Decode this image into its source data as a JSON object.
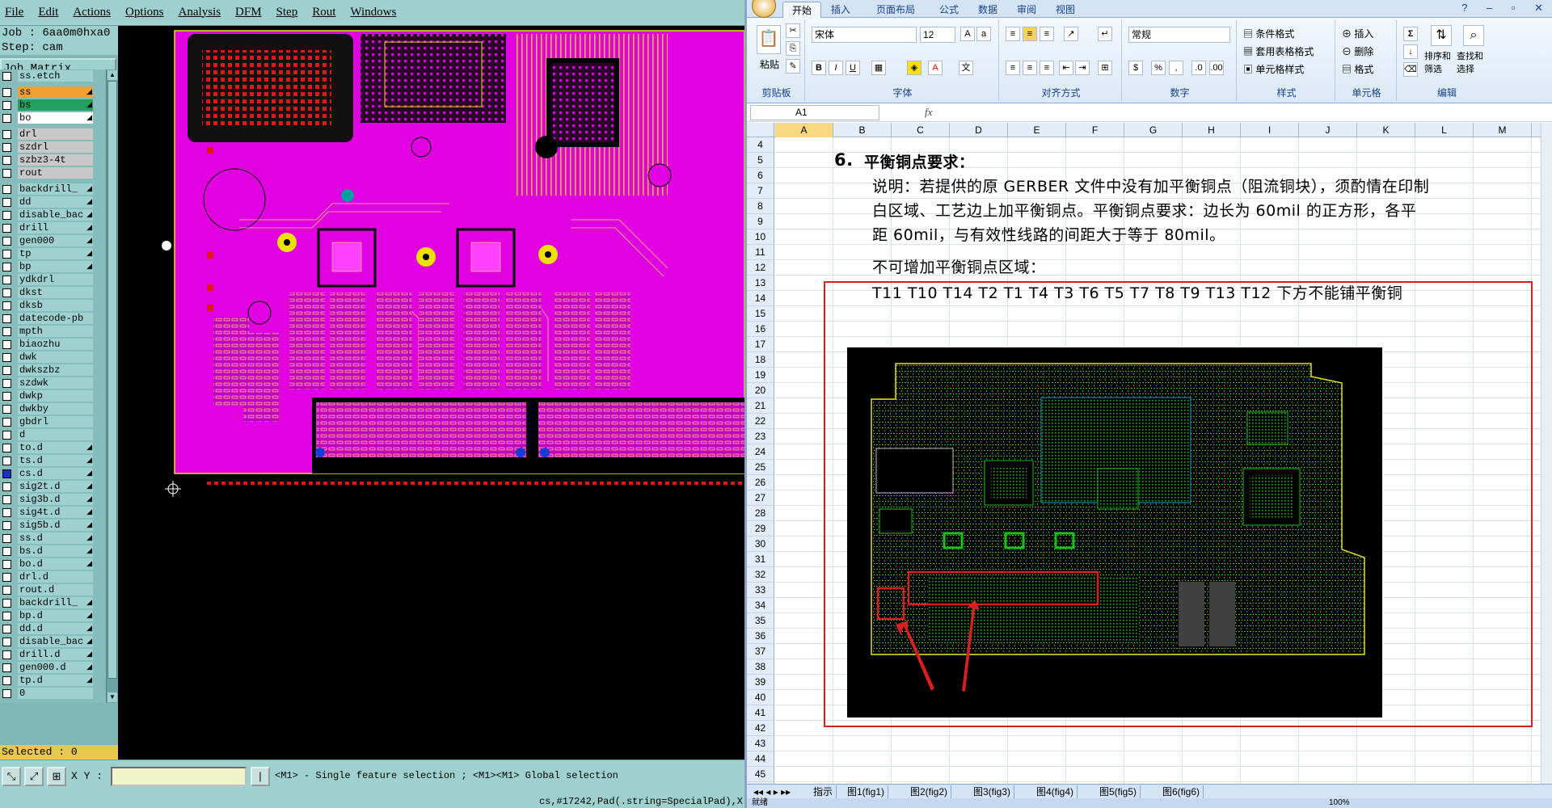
{
  "cam": {
    "menu": [
      "File",
      "Edit",
      "Actions",
      "Options",
      "Analysis",
      "DFM",
      "Step",
      "Rout",
      "Windows"
    ],
    "job_line": "Job : 6aa0m0hxa0",
    "step_line": "Step: cam",
    "job_matrix_button": "Job Matrix ...",
    "layers": [
      {
        "name": "ss.etch",
        "color": "#9fd0d0",
        "group_start": false
      },
      {
        "name": "ss",
        "color": "#f0a030",
        "group_start": true,
        "arrow": true
      },
      {
        "name": "bs",
        "color": "#20a060",
        "arrow": true
      },
      {
        "name": "bo",
        "color": "#ffffff",
        "arrow": true
      },
      {
        "name": "drl",
        "color": "#c8c8c8",
        "group_start": true
      },
      {
        "name": "szdrl",
        "color": "#c8c8c8"
      },
      {
        "name": "szbz3-4t",
        "color": "#c8c8c8"
      },
      {
        "name": "rout",
        "color": "#c8c8c8"
      },
      {
        "name": "backdrill_",
        "color": "#9fd0d0",
        "group_start": true,
        "arrow": true
      },
      {
        "name": "dd",
        "color": "#9fd0d0",
        "arrow": true
      },
      {
        "name": "disable_bac",
        "color": "#9fd0d0",
        "arrow": true
      },
      {
        "name": "drill",
        "color": "#9fd0d0",
        "arrow": true
      },
      {
        "name": "gen000",
        "color": "#9fd0d0",
        "arrow": true
      },
      {
        "name": "tp",
        "color": "#9fd0d0",
        "arrow": true
      },
      {
        "name": "bp",
        "color": "#9fd0d0",
        "arrow": true
      },
      {
        "name": "ydkdrl",
        "color": "#9fd0d0"
      },
      {
        "name": "dkst",
        "color": "#9fd0d0"
      },
      {
        "name": "dksb",
        "color": "#9fd0d0"
      },
      {
        "name": "datecode-pb",
        "color": "#9fd0d0"
      },
      {
        "name": "mpth",
        "color": "#9fd0d0"
      },
      {
        "name": "biaozhu",
        "color": "#9fd0d0"
      },
      {
        "name": "dwk",
        "color": "#9fd0d0"
      },
      {
        "name": "dwkszbz",
        "color": "#9fd0d0"
      },
      {
        "name": "szdwk",
        "color": "#9fd0d0"
      },
      {
        "name": "dwkp",
        "color": "#9fd0d0"
      },
      {
        "name": "dwkby",
        "color": "#9fd0d0"
      },
      {
        "name": "gbdrl",
        "color": "#9fd0d0"
      },
      {
        "name": "d",
        "color": "#9fd0d0"
      },
      {
        "name": "to.d",
        "color": "#9fd0d0",
        "arrow": true
      },
      {
        "name": "ts.d",
        "color": "#9fd0d0",
        "arrow": true
      },
      {
        "name": "cs.d",
        "color": "#9fd0d0",
        "arrow": true,
        "checked": true
      },
      {
        "name": "sig2t.d",
        "color": "#9fd0d0",
        "arrow": true
      },
      {
        "name": "sig3b.d",
        "color": "#9fd0d0",
        "arrow": true
      },
      {
        "name": "sig4t.d",
        "color": "#9fd0d0",
        "arrow": true
      },
      {
        "name": "sig5b.d",
        "color": "#9fd0d0",
        "arrow": true
      },
      {
        "name": "ss.d",
        "color": "#9fd0d0",
        "arrow": true
      },
      {
        "name": "bs.d",
        "color": "#9fd0d0",
        "arrow": true
      },
      {
        "name": "bo.d",
        "color": "#9fd0d0",
        "arrow": true
      },
      {
        "name": "drl.d",
        "color": "#9fd0d0"
      },
      {
        "name": "rout.d",
        "color": "#9fd0d0"
      },
      {
        "name": "backdrill_",
        "color": "#9fd0d0",
        "arrow": true
      },
      {
        "name": "bp.d",
        "color": "#9fd0d0",
        "arrow": true
      },
      {
        "name": "dd.d",
        "color": "#9fd0d0",
        "arrow": true
      },
      {
        "name": "disable_bac",
        "color": "#9fd0d0",
        "arrow": true
      },
      {
        "name": "drill.d",
        "color": "#9fd0d0",
        "arrow": true
      },
      {
        "name": "gen000.d",
        "color": "#9fd0d0",
        "arrow": true
      },
      {
        "name": "tp.d",
        "color": "#9fd0d0",
        "arrow": true
      },
      {
        "name": "0",
        "color": "#9fd0d0"
      }
    ],
    "selected": "Selected : 0",
    "xy_label": "X Y :",
    "xy_value": "",
    "hint": "<M1> - Single feature selection ; <M1><M1> Global selection",
    "status": "cs,#17242,Pad(.string=SpecialPad),X"
  },
  "excel": {
    "tabs": [
      "开始",
      "插入",
      "页面布局",
      "公式",
      "数据",
      "审阅",
      "视图"
    ],
    "clipboard": {
      "paste": "粘贴",
      "group": "剪贴板"
    },
    "font": {
      "name": "宋体",
      "size": "12",
      "group": "字体"
    },
    "align_group": "对齐方式",
    "number": {
      "format": "常规",
      "group": "数字"
    },
    "styles": {
      "cond": "条件格式",
      "table": "套用表格格式",
      "cell": "单元格样式",
      "group": "样式"
    },
    "cells": {
      "insert": "插入",
      "delete": "删除",
      "format": "格式",
      "group": "单元格"
    },
    "editing": {
      "sort": "排序和筛选",
      "find": "查找和选择",
      "group": "编辑"
    },
    "name_box": "A1",
    "fx": "fx",
    "columns": [
      "A",
      "B",
      "C",
      "D",
      "E",
      "F",
      "G",
      "H",
      "I",
      "J",
      "K",
      "L",
      "M"
    ],
    "rows": [
      "4",
      "5",
      "6",
      "7",
      "8",
      "9",
      "10",
      "11",
      "12",
      "13",
      "14",
      "15",
      "16",
      "17",
      "18",
      "19",
      "20",
      "21",
      "22",
      "23",
      "24",
      "25",
      "26",
      "27",
      "28",
      "29",
      "30",
      "31",
      "32",
      "33",
      "34",
      "35",
      "36",
      "37",
      "38",
      "39",
      "40",
      "41",
      "42",
      "43",
      "44",
      "45"
    ],
    "doc": {
      "heading_num": "6.",
      "heading": "平衡铜点要求：",
      "line1": "说明：若提供的原 GERBER 文件中没有加平衡铜点（阻流铜块），须酌情在印制",
      "line2": "白区域、工艺边上加平衡铜点。平衡铜点要求：边长为 60mil 的正方形，各平",
      "line3": "距 60mil，与有效性线路的间距大于等于 80mil。",
      "line4": "不可增加平衡铜点区域：",
      "line5": "T11 T10 T14 T2 T1 T4 T3 T6 T5 T7 T8 T9 T13 T12 下方不能铺平衡铜"
    },
    "sheet_tabs": [
      "指示",
      "图1(fig1)",
      "图2(fig2)",
      "图3(fig3)",
      "图4(fig4)",
      "图5(fig5)",
      "图6(fig6)"
    ],
    "status_left": "就绪",
    "zoom": "100%"
  },
  "colors": {
    "magenta": "#ff00ff",
    "pcb_green": "#18c018",
    "red": "#d62020",
    "cam_bg": "#9fd0d0"
  }
}
